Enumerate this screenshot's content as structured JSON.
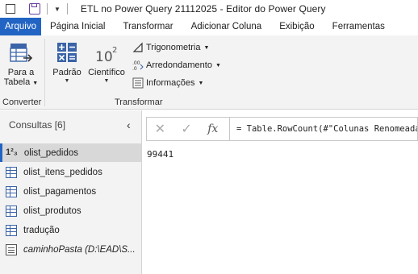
{
  "window": {
    "title": "ETL no Power Query 21112025 - Editor do Power Query"
  },
  "tabs": [
    {
      "label": "Arquivo",
      "active": true
    },
    {
      "label": "Página Inicial",
      "active": false
    },
    {
      "label": "Transformar",
      "active": false
    },
    {
      "label": "Adicionar Coluna",
      "active": false
    },
    {
      "label": "Exibição",
      "active": false
    },
    {
      "label": "Ferramentas",
      "active": false
    }
  ],
  "ribbon": {
    "converter": {
      "label": "Converter",
      "para_tabela_line1": "Para a",
      "para_tabela_line2": "Tabela"
    },
    "transformar": {
      "label": "Transformar",
      "padrao": "Padrão",
      "cientifico": "Científico",
      "trigonometria": "Trigonometria",
      "arredondamento": "Arredondamento",
      "informacoes": "Informações"
    }
  },
  "queries_pane": {
    "header": "Consultas [6]",
    "items": [
      {
        "label": "olist_pedidos",
        "icon": "number-icon",
        "selected": true
      },
      {
        "label": "olist_itens_pedidos",
        "icon": "table-icon",
        "selected": false
      },
      {
        "label": "olist_pagamentos",
        "icon": "table-icon",
        "selected": false
      },
      {
        "label": "olist_produtos",
        "icon": "table-icon",
        "selected": false
      },
      {
        "label": "tradução",
        "icon": "table-icon",
        "selected": false
      },
      {
        "label": "caminhoPasta (D:\\EAD\\S...",
        "icon": "parameter-icon",
        "selected": false
      }
    ]
  },
  "formula_bar": {
    "text": "= Table.RowCount(#\"Colunas Renomeadas\")"
  },
  "result": {
    "value": "99441"
  },
  "colors": {
    "accent": "#2264c4",
    "pane_bg": "#f3f3f3",
    "selected_bg": "#d8d8d8"
  }
}
